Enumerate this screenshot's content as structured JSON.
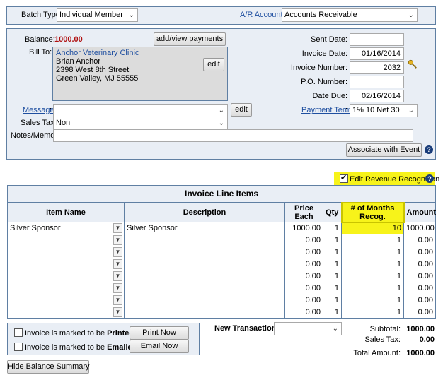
{
  "top": {
    "batch_type_label": "Batch Type:",
    "batch_type_value": "Individual Member",
    "ar_account_label": "A/R Account",
    "ar_account_value": "Accounts Receivable"
  },
  "invoice": {
    "balance_label": "Balance:",
    "balance_value": "1000.00",
    "add_view_payments": "add/view payments",
    "bill_to_label": "Bill To:",
    "bill_to_name": "Anchor Veterinary Clinic",
    "bill_to_contact": "Brian Anchor",
    "bill_to_street": "2398 West 8th Street",
    "bill_to_city": "Green Valley, MJ 55555",
    "edit": "edit",
    "sent_date_label": "Sent Date:",
    "sent_date_value": "",
    "invoice_date_label": "Invoice Date:",
    "invoice_date_value": "01/16/2014",
    "invoice_number_label": "Invoice Number:",
    "invoice_number_value": "2032",
    "po_number_label": "P.O. Number:",
    "po_number_value": "",
    "date_due_label": "Date Due:",
    "date_due_value": "02/16/2014",
    "message_label": "Message",
    "message_value": "",
    "message_edit": "edit",
    "payment_terms_label": "Payment Terms",
    "payment_terms_value": "1% 10 Net 30",
    "sales_tax_label": "Sales Tax:",
    "sales_tax_value": "Non",
    "notes_label": "Notes/Memo:",
    "notes_value": "",
    "associate_event": "Associate with Event"
  },
  "revenue": {
    "edit_revenue_label": "Edit Revenue Recognition"
  },
  "line_items": {
    "title": "Invoice Line Items",
    "headers": {
      "item_name": "Item Name",
      "description": "Description",
      "price_each_1": "Price",
      "price_each_2": "Each",
      "qty": "Qty",
      "months_1": "# of Months",
      "months_2": "Recog.",
      "amount": "Amount"
    },
    "rows": [
      {
        "item": "Silver Sponsor",
        "description": "Silver Sponsor",
        "price": "1000.00",
        "qty": "1",
        "months": "10",
        "amount": "1000.00"
      },
      {
        "item": "",
        "description": "",
        "price": "0.00",
        "qty": "1",
        "months": "1",
        "amount": "0.00"
      },
      {
        "item": "",
        "description": "",
        "price": "0.00",
        "qty": "1",
        "months": "1",
        "amount": "0.00"
      },
      {
        "item": "",
        "description": "",
        "price": "0.00",
        "qty": "1",
        "months": "1",
        "amount": "0.00"
      },
      {
        "item": "",
        "description": "",
        "price": "0.00",
        "qty": "1",
        "months": "1",
        "amount": "0.00"
      },
      {
        "item": "",
        "description": "",
        "price": "0.00",
        "qty": "1",
        "months": "1",
        "amount": "0.00"
      },
      {
        "item": "",
        "description": "",
        "price": "0.00",
        "qty": "1",
        "months": "1",
        "amount": "0.00"
      },
      {
        "item": "",
        "description": "",
        "price": "0.00",
        "qty": "1",
        "months": "1",
        "amount": "0.00"
      }
    ]
  },
  "footer": {
    "printed_prefix": "Invoice is marked to be ",
    "printed_bold": "Printed",
    "emailed_prefix": "Invoice is marked to be ",
    "emailed_bold": "Emailed",
    "print_now": "Print Now",
    "email_now": "Email Now",
    "new_transaction_label": "New Transaction:",
    "new_transaction_value": "",
    "subtotal_label": "Subtotal:",
    "subtotal_value": "1000.00",
    "sales_tax_label": "Sales Tax:",
    "sales_tax_value": "0.00",
    "total_label": "Total Amount:",
    "total_value": "1000.00",
    "hide_balance": "Hide Balance Summary"
  },
  "colors": {
    "panel_bg": "#e9eef5",
    "panel_border": "#5f7fa3",
    "highlight": "#f7f31a",
    "balance_red": "#b01010",
    "link_blue": "#1f4fa0"
  }
}
